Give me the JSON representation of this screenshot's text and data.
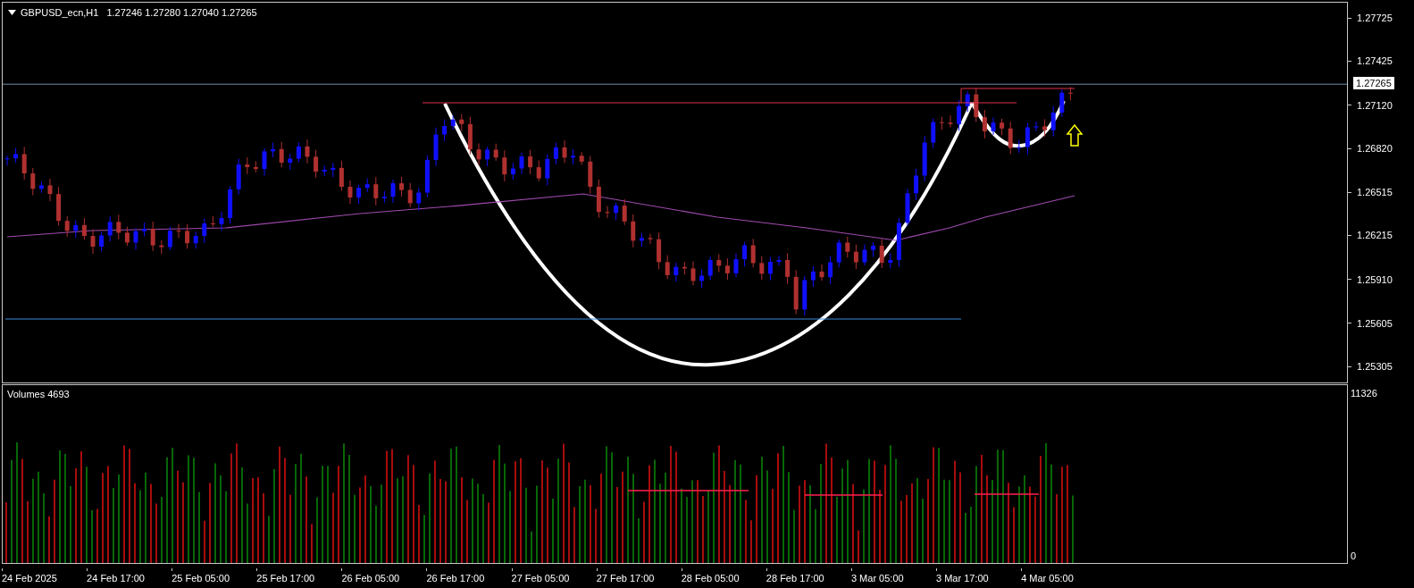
{
  "header": {
    "symbol": "GBPUSD_ecn,H1",
    "ohlc": "1.27246 1.27280 1.27040 1.27265"
  },
  "price_axis": {
    "ticks": [
      "1.27725",
      "1.27425",
      "1.27120",
      "1.26820",
      "1.26515",
      "1.26215",
      "1.25910",
      "1.25605",
      "1.25305"
    ],
    "current_price": "1.27265"
  },
  "volume_pane": {
    "label": "Volumes 4693",
    "axis_max": "11326",
    "axis_min": "0"
  },
  "time_axis": {
    "labels": [
      "24 Feb 2025",
      "24 Feb 17:00",
      "25 Feb 05:00",
      "25 Feb 17:00",
      "26 Feb 05:00",
      "26 Feb 17:00",
      "27 Feb 05:00",
      "27 Feb 17:00",
      "28 Feb 05:00",
      "28 Feb 17:00",
      "3 Mar 05:00",
      "3 Mar 17:00",
      "4 Mar 05:00"
    ]
  }
}
